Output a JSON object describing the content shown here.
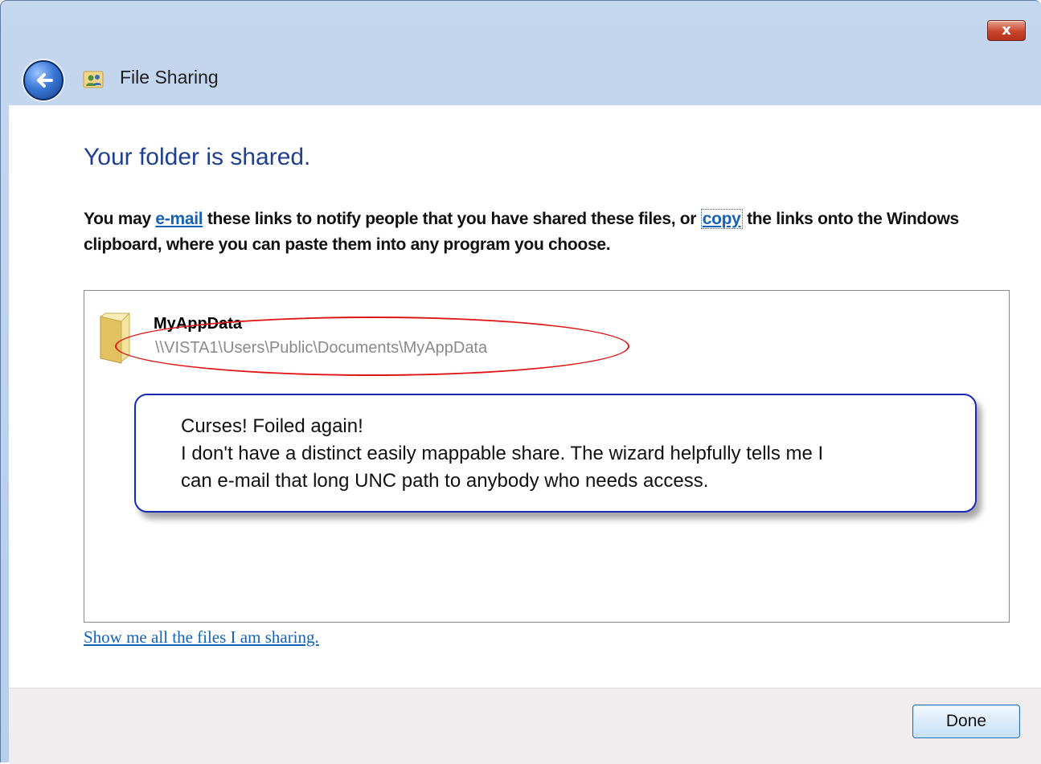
{
  "window": {
    "title": "File Sharing",
    "close_label": "x"
  },
  "main": {
    "heading": "Your folder is shared.",
    "desc_before_email": "You may ",
    "email_link": "e-mail",
    "desc_between": " these links to notify people that you have shared these files, or ",
    "copy_link": "copy",
    "desc_after_copy": " the links onto the Windows clipboard, where you can paste them into any program you choose."
  },
  "shared_items": [
    {
      "name": "MyAppData",
      "path": "\\\\VISTA1\\Users\\Public\\Documents\\MyAppData",
      "icon": "folder-icon"
    }
  ],
  "annotation": {
    "lines": [
      "Curses!  Foiled again!",
      "I don't have a distinct easily mappable share.  The wizard helpfully tells me I",
      "can e-mail that long UNC path to anybody who needs access."
    ],
    "border_color": "#1a28b8",
    "highlight_color": "#e01515"
  },
  "show_all_link": "Show me all the files I am sharing.",
  "footer": {
    "done_label": "Done"
  }
}
